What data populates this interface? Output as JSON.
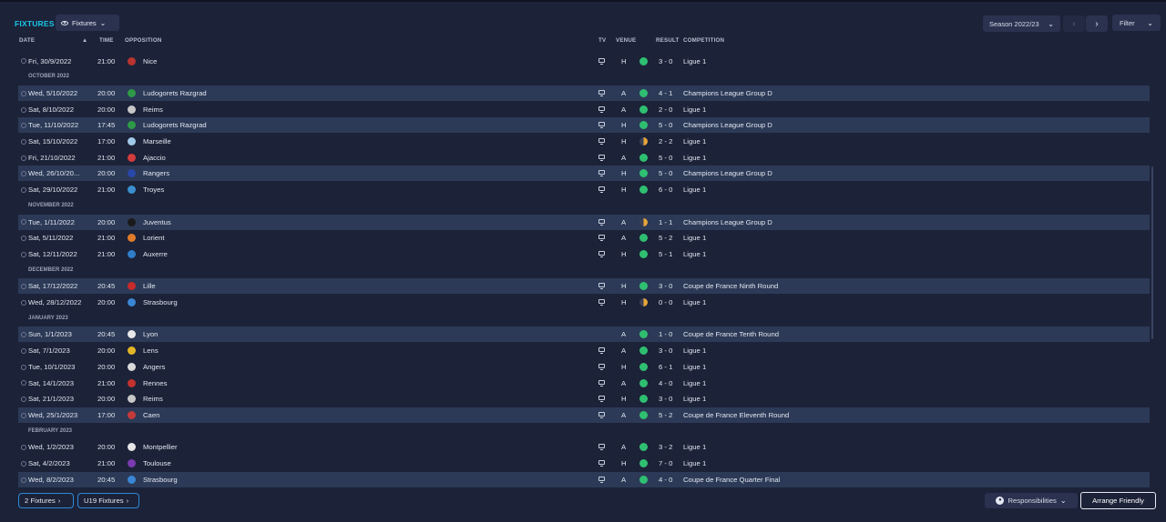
{
  "header": {
    "title": "FIXTURES",
    "view_button": "Fixtures",
    "season": "Season 2022/23",
    "filter": "Filter"
  },
  "columns": {
    "date": "DATE",
    "time": "TIME",
    "opposition": "OPPOSITION",
    "tv": "TV",
    "venue": "VENUE",
    "result": "RESULT",
    "competition": "COMPETITION"
  },
  "colors": {
    "accent": "#19c6e8",
    "win": "#2fbf71",
    "draw": "#e7a53a",
    "highlight_row": "#2c3a57"
  },
  "rows": [
    {
      "type": "match",
      "date": "Fri, 30/9/2022",
      "time": "21:00",
      "opponent": "Nice",
      "crest": "#b8342f",
      "tv": true,
      "venue": "H",
      "result": "win",
      "score": "3 - 0",
      "competition": "Ligue 1",
      "hl": false
    },
    {
      "type": "month",
      "label": "OCTOBER 2022"
    },
    {
      "type": "match",
      "date": "Wed, 5/10/2022",
      "time": "20:00",
      "opponent": "Ludogorets Razgrad",
      "crest": "#2e9a47",
      "tv": true,
      "venue": "A",
      "result": "win",
      "score": "4 - 1",
      "competition": "Champions League Group D",
      "hl": true
    },
    {
      "type": "match",
      "date": "Sat, 8/10/2022",
      "time": "20:00",
      "opponent": "Reims",
      "crest": "#c7c7c7",
      "tv": true,
      "venue": "A",
      "result": "win",
      "score": "2 - 0",
      "competition": "Ligue 1",
      "hl": false
    },
    {
      "type": "match",
      "date": "Tue, 11/10/2022",
      "time": "17:45",
      "opponent": "Ludogorets Razgrad",
      "crest": "#2e9a47",
      "tv": true,
      "venue": "H",
      "result": "win",
      "score": "5 - 0",
      "competition": "Champions League Group D",
      "hl": true
    },
    {
      "type": "match",
      "date": "Sat, 15/10/2022",
      "time": "17:00",
      "opponent": "Marseille",
      "crest": "#9fc8e8",
      "tv": true,
      "venue": "H",
      "result": "draw",
      "score": "2 - 2",
      "competition": "Ligue 1",
      "hl": false
    },
    {
      "type": "match",
      "date": "Fri, 21/10/2022",
      "time": "21:00",
      "opponent": "Ajaccio",
      "crest": "#d33c3c",
      "tv": true,
      "venue": "A",
      "result": "win",
      "score": "5 - 0",
      "competition": "Ligue 1",
      "hl": false
    },
    {
      "type": "match",
      "date": "Wed, 26/10/20...",
      "time": "20:00",
      "opponent": "Rangers",
      "crest": "#2848a8",
      "tv": true,
      "venue": "H",
      "result": "win",
      "score": "5 - 0",
      "competition": "Champions League Group D",
      "hl": true
    },
    {
      "type": "match",
      "date": "Sat, 29/10/2022",
      "time": "21:00",
      "opponent": "Troyes",
      "crest": "#3b8fd0",
      "tv": true,
      "venue": "H",
      "result": "win",
      "score": "6 - 0",
      "competition": "Ligue 1",
      "hl": false
    },
    {
      "type": "month",
      "label": "NOVEMBER 2022"
    },
    {
      "type": "match",
      "date": "Tue, 1/11/2022",
      "time": "20:00",
      "opponent": "Juventus",
      "crest": "#1a1a1a",
      "tv": true,
      "venue": "A",
      "result": "draw",
      "score": "1 - 1",
      "competition": "Champions League Group D",
      "hl": true
    },
    {
      "type": "match",
      "date": "Sat, 5/11/2022",
      "time": "21:00",
      "opponent": "Lorient",
      "crest": "#e07b2a",
      "tv": true,
      "venue": "A",
      "result": "win",
      "score": "5 - 2",
      "competition": "Ligue 1",
      "hl": false
    },
    {
      "type": "match",
      "date": "Sat, 12/11/2022",
      "time": "21:00",
      "opponent": "Auxerre",
      "crest": "#2f7ec9",
      "tv": true,
      "venue": "H",
      "result": "win",
      "score": "5 - 1",
      "competition": "Ligue 1",
      "hl": false
    },
    {
      "type": "month",
      "label": "DECEMBER 2022"
    },
    {
      "type": "match",
      "date": "Sat, 17/12/2022",
      "time": "20:45",
      "opponent": "Lille",
      "crest": "#c72b2b",
      "tv": true,
      "venue": "H",
      "result": "win",
      "score": "3 - 0",
      "competition": "Coupe de France Ninth Round",
      "hl": true
    },
    {
      "type": "match",
      "date": "Wed, 28/12/2022",
      "time": "20:00",
      "opponent": "Strasbourg",
      "crest": "#3a86d4",
      "tv": true,
      "venue": "H",
      "result": "draw",
      "score": "0 - 0",
      "competition": "Ligue 1",
      "hl": false
    },
    {
      "type": "month",
      "label": "JANUARY 2023"
    },
    {
      "type": "match",
      "date": "Sun, 1/1/2023",
      "time": "20:45",
      "opponent": "Lyon",
      "crest": "#e8e8e8",
      "tv": false,
      "venue": "A",
      "result": "win",
      "score": "1 - 0",
      "competition": "Coupe de France Tenth Round",
      "hl": true
    },
    {
      "type": "match",
      "date": "Sat, 7/1/2023",
      "time": "20:00",
      "opponent": "Lens",
      "crest": "#e2b526",
      "tv": true,
      "venue": "A",
      "result": "win",
      "score": "3 - 0",
      "competition": "Ligue 1",
      "hl": false
    },
    {
      "type": "match",
      "date": "Tue, 10/1/2023",
      "time": "20:00",
      "opponent": "Angers",
      "crest": "#d9d9d9",
      "tv": true,
      "venue": "H",
      "result": "win",
      "score": "6 - 1",
      "competition": "Ligue 1",
      "hl": false
    },
    {
      "type": "match",
      "date": "Sat, 14/1/2023",
      "time": "21:00",
      "opponent": "Rennes",
      "crest": "#c2322f",
      "tv": true,
      "venue": "A",
      "result": "win",
      "score": "4 - 0",
      "competition": "Ligue 1",
      "hl": false
    },
    {
      "type": "match",
      "date": "Sat, 21/1/2023",
      "time": "20:00",
      "opponent": "Reims",
      "crest": "#c7c7c7",
      "tv": true,
      "venue": "H",
      "result": "win",
      "score": "3 - 0",
      "competition": "Ligue 1",
      "hl": false
    },
    {
      "type": "match",
      "date": "Wed, 25/1/2023",
      "time": "17:00",
      "opponent": "Caen",
      "crest": "#c43a3a",
      "tv": true,
      "venue": "A",
      "result": "win",
      "score": "5 - 2",
      "competition": "Coupe de France Eleventh Round",
      "hl": true
    },
    {
      "type": "month",
      "label": "FEBRUARY 2023"
    },
    {
      "type": "match",
      "date": "Wed, 1/2/2023",
      "time": "20:00",
      "opponent": "Montpellier",
      "crest": "#e6e6e6",
      "tv": true,
      "venue": "A",
      "result": "win",
      "score": "3 - 2",
      "competition": "Ligue 1",
      "hl": false
    },
    {
      "type": "match",
      "date": "Sat, 4/2/2023",
      "time": "21:00",
      "opponent": "Toulouse",
      "crest": "#7a3bb0",
      "tv": true,
      "venue": "H",
      "result": "win",
      "score": "7 - 0",
      "competition": "Ligue 1",
      "hl": false
    },
    {
      "type": "match",
      "date": "Wed, 8/2/2023",
      "time": "20:45",
      "opponent": "Strasbourg",
      "crest": "#3a86d4",
      "tv": true,
      "venue": "A",
      "result": "win",
      "score": "4 - 0",
      "competition": "Coupe de France Quarter Final",
      "hl": true
    }
  ],
  "footer": {
    "fixtures_link": "2 Fixtures",
    "u19_link": "U19 Fixtures",
    "responsibilities": "Responsibilities",
    "arrange_friendly": "Arrange Friendly"
  }
}
